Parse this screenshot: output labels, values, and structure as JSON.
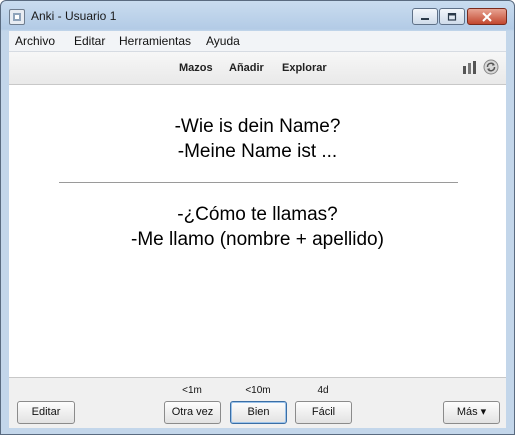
{
  "window": {
    "title": "Anki - Usuario 1"
  },
  "menu": [
    "Archivo",
    "Editar",
    "Herramientas",
    "Ayuda"
  ],
  "toolbar": {
    "decks": "Mazos",
    "add": "Añadir",
    "browse": "Explorar"
  },
  "card": {
    "front": [
      "-Wie is dein Name?",
      "-Meine Name ist ..."
    ],
    "back": [
      "-¿Cómo te llamas?",
      "-Me llamo (nombre + apellido)"
    ]
  },
  "bottom": {
    "edit": "Editar",
    "intervals": [
      "<1m",
      "<10m",
      "4d"
    ],
    "answers": [
      "Otra vez",
      "Bien",
      "Fácil"
    ],
    "more": "Más ▾"
  },
  "icons": [
    "app-icon",
    "minimize-icon",
    "maximize-icon",
    "close-icon",
    "stats-icon",
    "sync-icon"
  ],
  "colors": {
    "titlebar": "#b3cbe6",
    "close": "#c2472f",
    "focus": "#3a6ea5"
  }
}
